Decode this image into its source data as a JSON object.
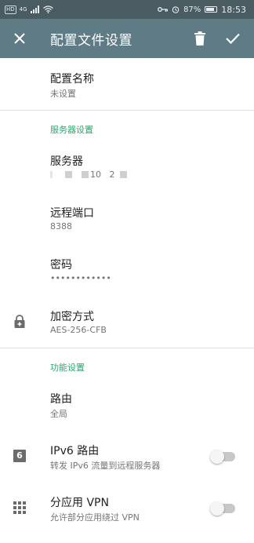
{
  "statusbar": {
    "left_chip": "HD",
    "signal_text": "4G",
    "battery_text": "87%",
    "time": "18:53"
  },
  "appbar": {
    "title": "配置文件设置"
  },
  "profile": {
    "name_label": "配置名称",
    "name_value": "未设置"
  },
  "server_section": {
    "header": "服务器设置",
    "server_label": "服务器",
    "server_value_visible": "10   2",
    "port_label": "远程端口",
    "port_value": "8388",
    "password_label": "密码",
    "password_value": "••••••••••••",
    "encryption_label": "加密方式",
    "encryption_value": "AES-256-CFB"
  },
  "feature_section": {
    "header": "功能设置",
    "route_label": "路由",
    "route_value": "全局",
    "ipv6_label": "IPv6 路由",
    "ipv6_desc": "转发 IPv6 流量到远程服务器",
    "ipv6_icon_text": "6",
    "per_app_label": "分应用 VPN",
    "per_app_desc": "允许部分应用绕过 VPN"
  },
  "toggles": {
    "ipv6_enabled": false,
    "per_app_enabled": false
  },
  "colors": {
    "statusbar": "#4a5b62",
    "appbar": "#5f7b86",
    "section_header": "#2ea66f",
    "icon": "#6b6b6b"
  }
}
